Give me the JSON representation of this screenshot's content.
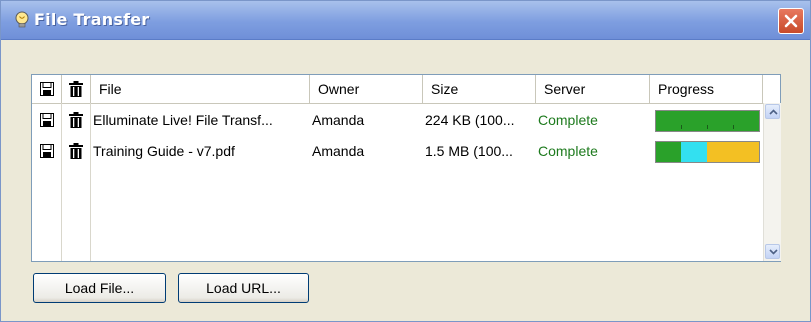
{
  "window": {
    "title": "File Transfer"
  },
  "columns": [
    "File",
    "Owner",
    "Size",
    "Server",
    "Progress"
  ],
  "rows": [
    {
      "file": "Elluminate Live! File Transf...",
      "owner": "Amanda",
      "size": "224 KB (100...",
      "server": "Complete",
      "progress": 1.0
    },
    {
      "file": "Training Guide - v7.pdf",
      "owner": "Amanda",
      "size": "1.5 MB (100...",
      "server": "Complete",
      "progress": 1.0
    }
  ],
  "buttons": {
    "load_file": "Load File...",
    "load_url": "Load URL..."
  },
  "colors": {
    "titlebar": "#7e9ee0",
    "progress_green": "#2aa12a",
    "progress_cyan": "#33e0f0",
    "progress_yellow": "#f3c023",
    "status_green": "#1d7a1d"
  },
  "icons": {
    "title": "lightbulb-icon",
    "save": "floppy-disk-icon",
    "delete": "trash-can-icon"
  }
}
